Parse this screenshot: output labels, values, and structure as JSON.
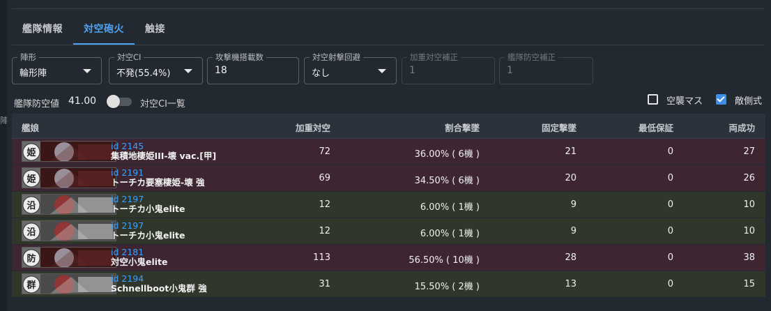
{
  "tabs": [
    "艦隊情報",
    "対空砲火",
    "触接"
  ],
  "active_tab": 1,
  "edge_glyph": "陣",
  "fields": {
    "formation": {
      "label": "陣形",
      "value": "輪形陣"
    },
    "ci": {
      "label": "対空CI",
      "value": "不発(55.4%)"
    },
    "bombers": {
      "label": "攻撃機搭載数",
      "value": "18"
    },
    "evasion": {
      "label": "対空射撃回避",
      "value": "なし"
    },
    "bonus_aa": {
      "label": "加重対空補正",
      "value": "1"
    },
    "fleet_aa_mod": {
      "label": "艦隊防空補正",
      "value": "1"
    }
  },
  "fleet_aa": {
    "label": "艦隊防空値",
    "value": "41.00"
  },
  "ci_list_toggle": {
    "label": "対空CI一覧",
    "on": false
  },
  "checks": {
    "air_raid": {
      "label": "空襲マス",
      "checked": false
    },
    "enemy_formula": {
      "label": "敵側式",
      "checked": true
    }
  },
  "columns": [
    "艦娘",
    "加重対空",
    "割合撃墜",
    "固定撃墜",
    "最低保証",
    "両成功"
  ],
  "rows": [
    {
      "id": "id 2145",
      "name": "集積地棲姫III-壊 vac.[甲]",
      "weighted": "72",
      "ratio": "36.00% ( 6機 )",
      "fixed": "21",
      "min": "0",
      "both": "27",
      "kind": "boss",
      "mark": "姫"
    },
    {
      "id": "id 2191",
      "name": "トーチカ要塞棲姫-壊 強",
      "weighted": "69",
      "ratio": "34.50% ( 6機 )",
      "fixed": "20",
      "min": "0",
      "both": "26",
      "kind": "boss",
      "mark": "姫"
    },
    {
      "id": "id 2197",
      "name": "トーチカ小鬼elite",
      "weighted": "12",
      "ratio": "6.00% ( 1機 )",
      "fixed": "9",
      "min": "0",
      "both": "10",
      "kind": "minor",
      "mark": "沿"
    },
    {
      "id": "id 2197",
      "name": "トーチカ小鬼elite",
      "weighted": "12",
      "ratio": "6.00% ( 1機 )",
      "fixed": "9",
      "min": "0",
      "both": "10",
      "kind": "minor",
      "mark": "沿"
    },
    {
      "id": "id 2181",
      "name": "対空小鬼elite",
      "weighted": "113",
      "ratio": "56.50% ( 10機 )",
      "fixed": "28",
      "min": "0",
      "both": "38",
      "kind": "boss",
      "mark": "防"
    },
    {
      "id": "id 2194",
      "name": "Schnellboot小鬼群 強",
      "weighted": "31",
      "ratio": "15.50% ( 2機 )",
      "fixed": "13",
      "min": "0",
      "both": "15",
      "kind": "minor",
      "mark": "群"
    }
  ],
  "colors": {
    "accent": "#4da3f4",
    "boss_row": "#3d2631",
    "minor_row": "#31362b",
    "id_link": "#3ea0ff"
  }
}
